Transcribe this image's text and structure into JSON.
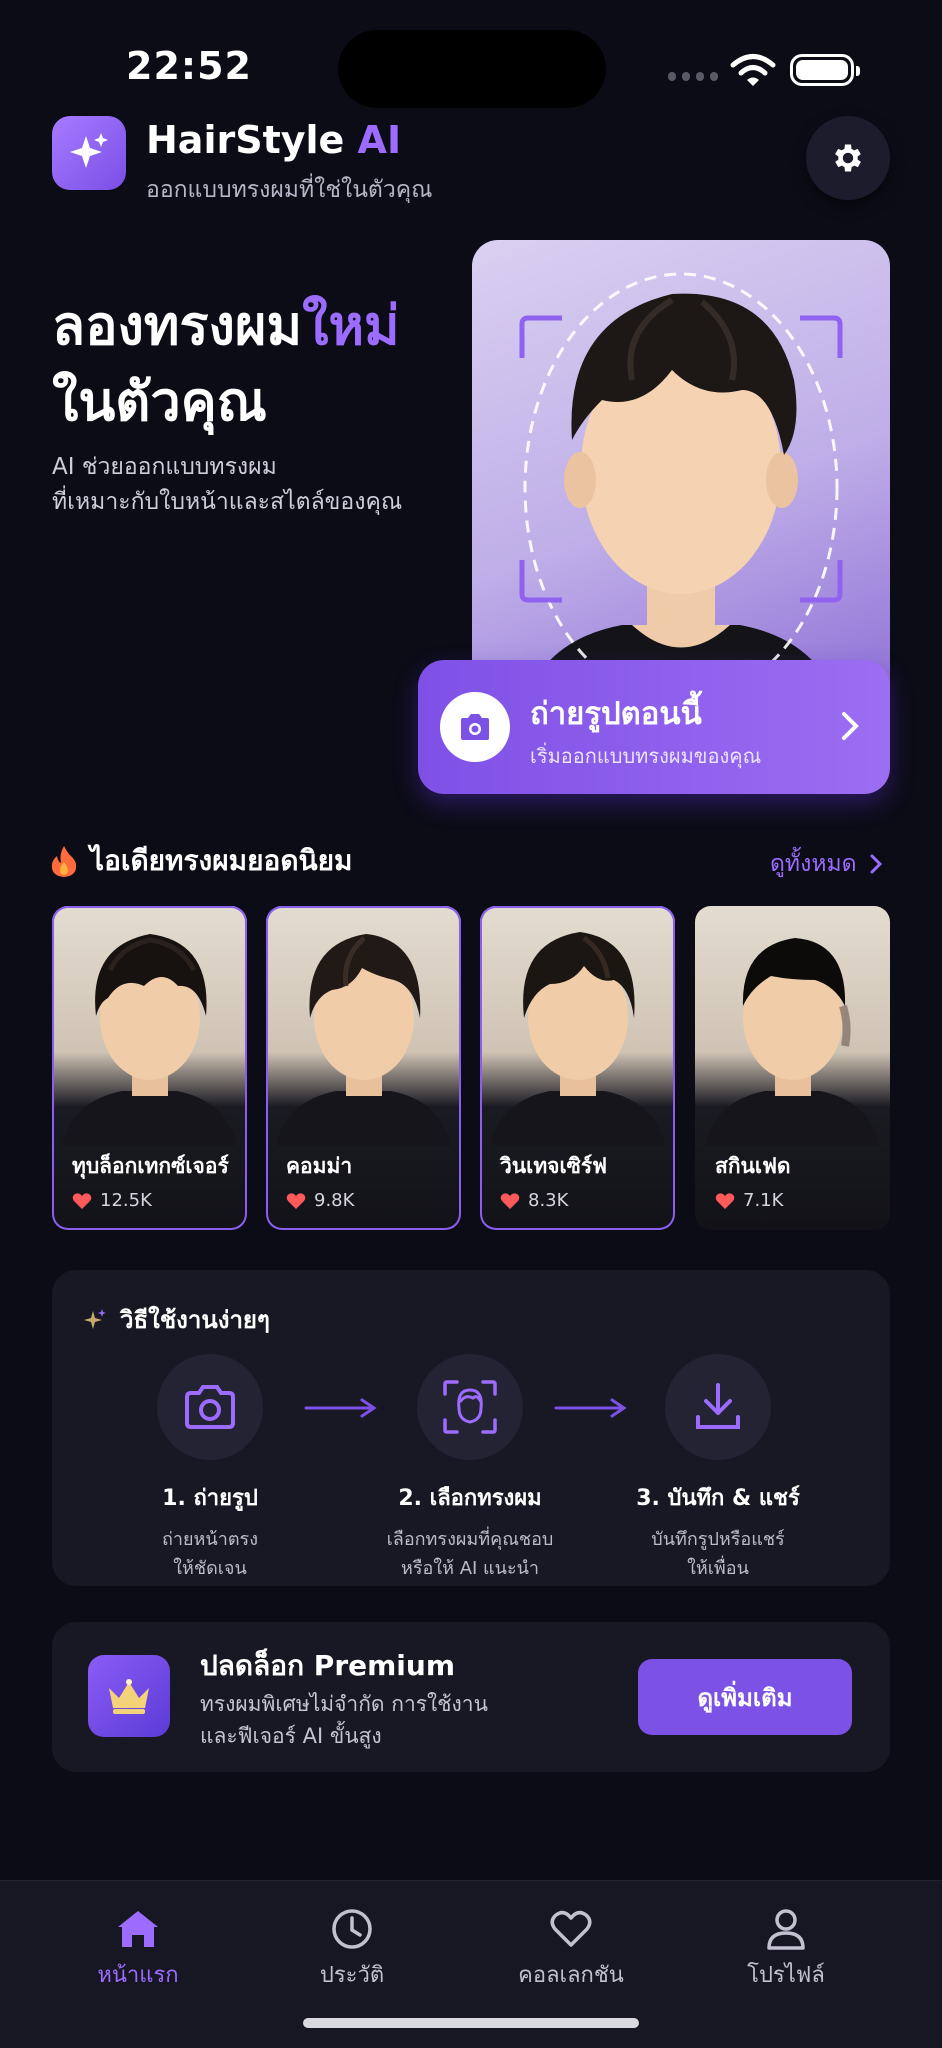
{
  "status": {
    "time": "22:52"
  },
  "header": {
    "brand_main": "HairStyle",
    "brand_ai": "AI",
    "tagline": "ออกแบบทรงผมที่ใช่ในตัวคุณ",
    "logo_icon": "sparkles-icon",
    "settings_icon": "gear-icon"
  },
  "hero": {
    "title_line1": "ลองทรงผม",
    "title_accent": "ใหม่",
    "title_line2": "ในตัวคุณ",
    "subtitle_line1": "AI ช่วยออกแบบทรงผม",
    "subtitle_line2": "ที่เหมาะกับใบหน้าและสไตล์ของคุณ"
  },
  "cta": {
    "title": "ถ่ายรูปตอนนี้",
    "subtitle": "เริ่มออกแบบทรงผมของคุณ",
    "icon": "camera-icon"
  },
  "popular": {
    "title": "ไอเดียทรงผมยอดนิยม",
    "see_all": "ดูทั้งหมด",
    "items": [
      {
        "name": "ทุบล็อกเทกซ์เจอร์",
        "likes": "12.5K"
      },
      {
        "name": "คอมม่า",
        "likes": "9.8K"
      },
      {
        "name": "วินเทจเซิร์ฟ",
        "likes": "8.3K"
      },
      {
        "name": "สกินเฟด",
        "likes": "7.1K"
      }
    ]
  },
  "howto": {
    "title": "วิธีใช้งานง่ายๆ",
    "steps": [
      {
        "title": "1. ถ่ายรูป",
        "desc_line1": "ถ่ายหน้าตรง",
        "desc_line2": "ให้ชัดเจน",
        "icon": "camera-icon"
      },
      {
        "title": "2. เลือกทรงผม",
        "desc_line1": "เลือกทรงผมที่คุณชอบ",
        "desc_line2": "หรือให้ AI แนะนำ",
        "icon": "face-scan-icon"
      },
      {
        "title": "3. บันทึก & แชร์",
        "desc_line1": "บันทึกรูปหรือแชร์",
        "desc_line2": "ให้เพื่อน",
        "icon": "download-icon"
      }
    ]
  },
  "premium": {
    "title": "ปลดล็อก Premium",
    "desc_line1": "ทรงผมพิเศษไม่จำกัด การใช้งาน",
    "desc_line2": "และฟีเจอร์ AI ขั้นสูง",
    "button": "ดูเพิ่มเติม",
    "icon": "crown-icon"
  },
  "tabs": [
    {
      "label": "หน้าแรก",
      "icon": "home-icon",
      "active": true
    },
    {
      "label": "ประวัติ",
      "icon": "clock-icon",
      "active": false
    },
    {
      "label": "คอลเลกชัน",
      "icon": "heart-icon",
      "active": false
    },
    {
      "label": "โปรไฟล์",
      "icon": "user-icon",
      "active": false
    }
  ],
  "colors": {
    "accent": "#9b6cff",
    "background": "#0c0c17",
    "card": "#181824",
    "heart": "#ff5a5a"
  }
}
